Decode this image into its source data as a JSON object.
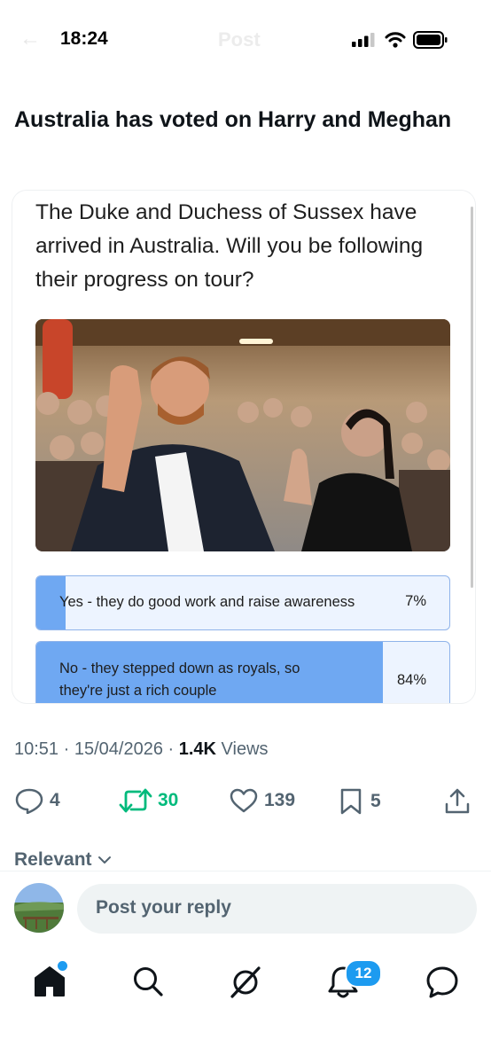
{
  "status_bar": {
    "time": "18:24"
  },
  "header": {
    "title": "Post"
  },
  "tweet": {
    "text": "Australia has voted on Harry and Meghan",
    "meta": {
      "time": "10:51",
      "date": "15/04/2026",
      "views_count": "1.4K",
      "views_label": "Views"
    },
    "actions": {
      "replies": "4",
      "reposts": "30",
      "likes": "139",
      "bookmarks": "5"
    }
  },
  "poll_card": {
    "question": "The Duke and Duchess of Sussex have arrived in Australia. Will you be following their progress on tour?",
    "options": [
      {
        "label": "Yes - they do good work and raise awareness",
        "percent_text": "7%",
        "percent": 7
      },
      {
        "label": "No - they stepped down as royals, so they're just a rich couple",
        "percent_text": "84%",
        "percent": 84
      }
    ]
  },
  "replies_sort": {
    "label": "Relevant"
  },
  "reply_box": {
    "placeholder": "Post your reply"
  },
  "bottom_nav": {
    "items": [
      "home",
      "search",
      "grok",
      "notifications",
      "messages"
    ],
    "notifications_badge": "12"
  },
  "colors": {
    "accent": "#1d9bf0",
    "repost_green": "#00ba7c",
    "poll_fill": "#6fa8f2",
    "poll_track": "#edf4ff"
  }
}
